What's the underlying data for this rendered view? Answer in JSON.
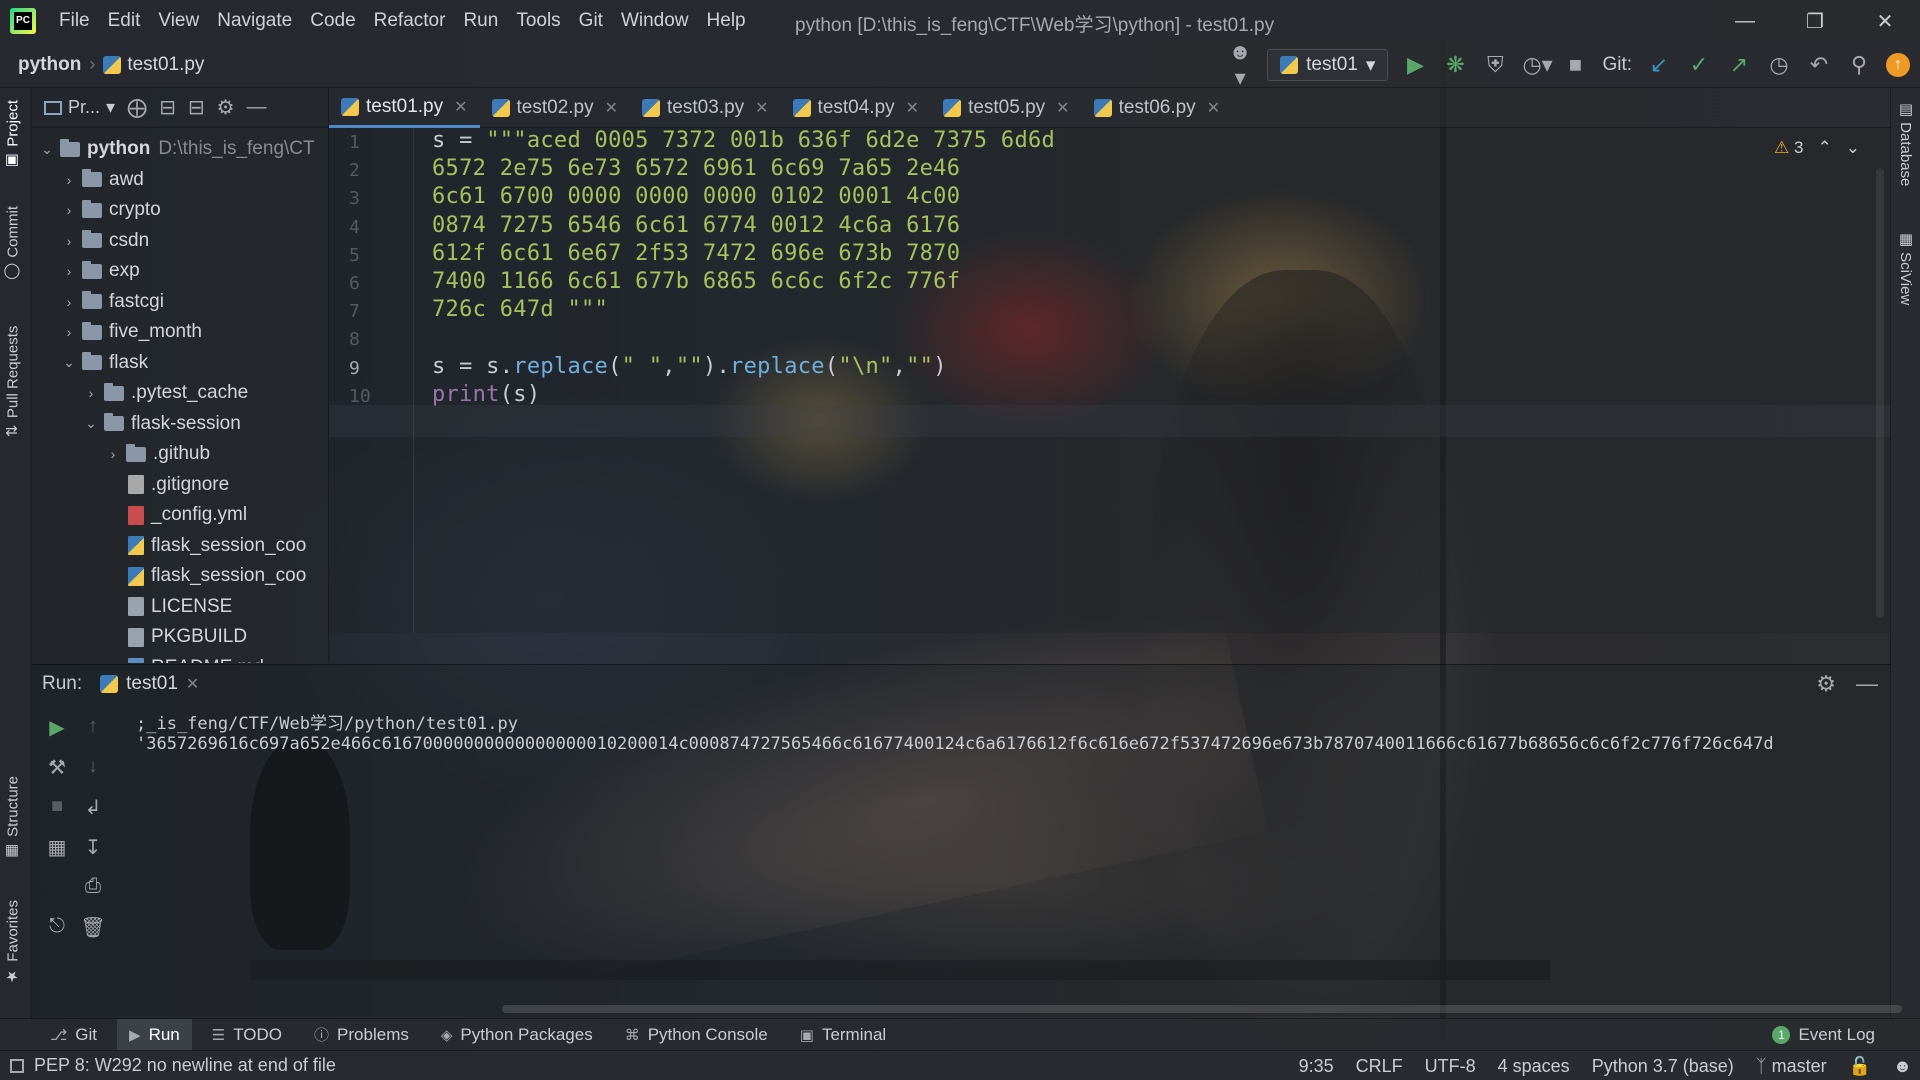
{
  "menubar": {
    "items": [
      "File",
      "Edit",
      "View",
      "Navigate",
      "Code",
      "Refactor",
      "Run",
      "Tools",
      "Git",
      "Window",
      "Help"
    ],
    "title": "python [D:\\this_is_feng\\CTF\\Web学习\\python] - test01.py"
  },
  "navbar": {
    "project": "python",
    "file": "test01.py",
    "run_config": "test01",
    "git_label": "Git:"
  },
  "left_strip": {
    "tabs": [
      "Project",
      "Commit",
      "Pull Requests",
      "Structure",
      "Favorites"
    ]
  },
  "right_strip": {
    "tabs": [
      "Database",
      "SciView"
    ]
  },
  "project_panel": {
    "title": "Pr...",
    "tree": [
      {
        "label": "python",
        "path": "D:\\this_is_feng\\CT",
        "type": "folder",
        "expanded": true,
        "depth": 0,
        "bold": true
      },
      {
        "label": "awd",
        "type": "folder",
        "expanded": false,
        "depth": 1
      },
      {
        "label": "crypto",
        "type": "folder",
        "expanded": false,
        "depth": 1
      },
      {
        "label": "csdn",
        "type": "folder",
        "expanded": false,
        "depth": 1
      },
      {
        "label": "exp",
        "type": "folder",
        "expanded": false,
        "depth": 1
      },
      {
        "label": "fastcgi",
        "type": "folder",
        "expanded": false,
        "depth": 1
      },
      {
        "label": "five_month",
        "type": "folder",
        "expanded": false,
        "depth": 1
      },
      {
        "label": "flask",
        "type": "folder",
        "expanded": true,
        "depth": 1
      },
      {
        "label": ".pytest_cache",
        "type": "folder",
        "expanded": false,
        "depth": 2
      },
      {
        "label": "flask-session",
        "type": "folder",
        "expanded": true,
        "depth": 2
      },
      {
        "label": ".github",
        "type": "folder",
        "expanded": false,
        "depth": 3
      },
      {
        "label": ".gitignore",
        "type": "git",
        "depth": 3
      },
      {
        "label": "_config.yml",
        "type": "yml",
        "depth": 3
      },
      {
        "label": "flask_session_coo",
        "type": "py",
        "depth": 3
      },
      {
        "label": "flask_session_coo",
        "type": "py",
        "depth": 3
      },
      {
        "label": "LICENSE",
        "type": "file",
        "depth": 3
      },
      {
        "label": "PKGBUILD",
        "type": "file",
        "depth": 3
      },
      {
        "label": "README.md",
        "type": "md",
        "depth": 3
      }
    ]
  },
  "editor": {
    "tabs": [
      "test01.py",
      "test02.py",
      "test03.py",
      "test04.py",
      "test05.py",
      "test06.py"
    ],
    "active_tab": "test01.py",
    "warning_count": "3",
    "line_numbers": [
      "1",
      "2",
      "3",
      "4",
      "5",
      "6",
      "7",
      "8",
      "9",
      "10"
    ],
    "lines": [
      [
        {
          "t": "s = ",
          "c": ""
        },
        {
          "t": "\"\"\"aced 0005 7372 001b 636f 6d2e 7375 6d6d",
          "c": "str"
        }
      ],
      [
        {
          "t": "6572 2e75 6e73 6572 6961 6c69 7a65 2e46",
          "c": "str"
        }
      ],
      [
        {
          "t": "6c61 6700 0000 0000 0000 0102 0001 4c00",
          "c": "str"
        }
      ],
      [
        {
          "t": "0874 7275 6546 6c61 6774 0012 4c6a 6176",
          "c": "str"
        }
      ],
      [
        {
          "t": "612f 6c61 6e67 2f53 7472 696e 673b 7870",
          "c": "str"
        }
      ],
      [
        {
          "t": "7400 1166 6c61 677b 6865 6c6c 6f2c 776f",
          "c": "str"
        }
      ],
      [
        {
          "t": "726c 647d \"\"\"",
          "c": "str"
        }
      ],
      [],
      [
        {
          "t": "s = s.",
          "c": ""
        },
        {
          "t": "replace",
          "c": "fn"
        },
        {
          "t": "(",
          "c": ""
        },
        {
          "t": "\" \"",
          "c": "str"
        },
        {
          "t": ",",
          "c": ""
        },
        {
          "t": "\"\"",
          "c": "str"
        },
        {
          "t": ").",
          "c": ""
        },
        {
          "t": "replace",
          "c": "fn"
        },
        {
          "t": "(",
          "c": ""
        },
        {
          "t": "\"\\n\"",
          "c": "str"
        },
        {
          "t": ",",
          "c": ""
        },
        {
          "t": "\"\"",
          "c": "str"
        },
        {
          "t": ")",
          "c": ""
        }
      ],
      [
        {
          "t": "print",
          "c": "builtin"
        },
        {
          "t": "(s)",
          "c": ""
        }
      ]
    ]
  },
  "run_panel": {
    "label": "Run:",
    "tab": "test01",
    "output": [
      ";_is_feng/CTF/Web学习/python/test01.py",
      "'3657269616c697a652e466c61670000000000000000010200014c000874727565466c61677400124c6a6176612f6c616e672f537472696e673b7870740011666c61677b68656c6c6f2c776f726c647d"
    ]
  },
  "bottom_bar": {
    "items": [
      "Git",
      "Run",
      "TODO",
      "Problems",
      "Python Packages",
      "Python Console",
      "Terminal"
    ],
    "active": "Run",
    "event_log": "Event Log",
    "event_count": "1"
  },
  "status_bar": {
    "message": "PEP 8: W292 no newline at end of file",
    "position": "9:35",
    "line_sep": "CRLF",
    "encoding": "UTF-8",
    "indent": "4 spaces",
    "interpreter": "Python 3.7 (base)",
    "branch": "master"
  }
}
